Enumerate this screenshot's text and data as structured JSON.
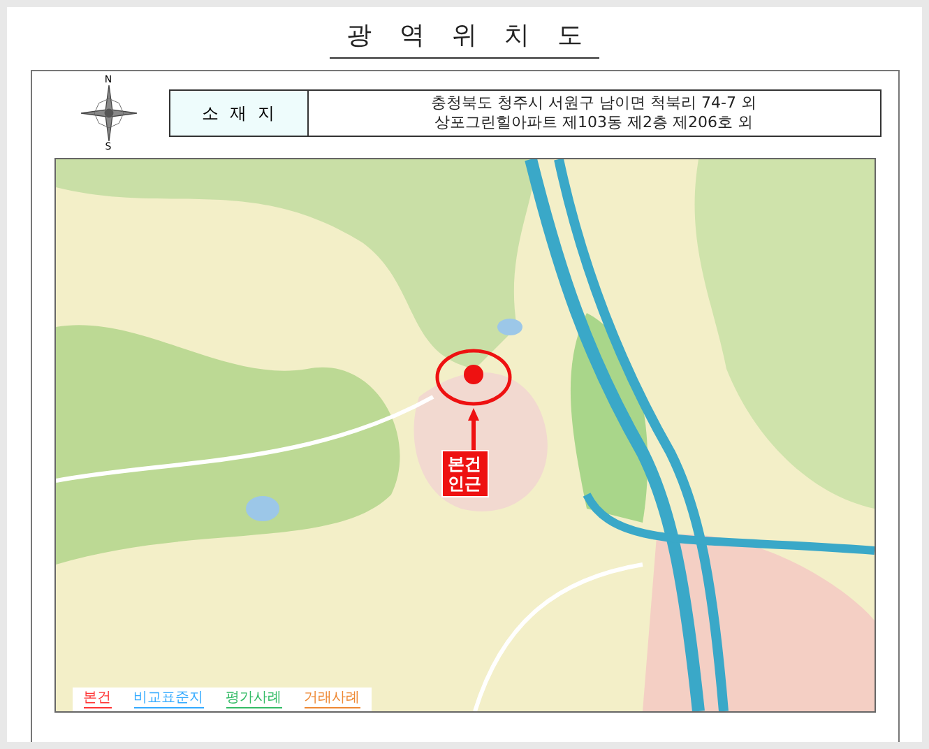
{
  "title": "광 역 위 치 도",
  "location": {
    "label": "소 재 지",
    "lines": [
      "충청북도 청주시 서원구 남이면 척북리 74-7 외",
      "상포그린힐아파트 제103동 제2층 제206호 외"
    ]
  },
  "compass": {
    "north": "N",
    "south": "S"
  },
  "map": {
    "marker_label": [
      "본건",
      "인근"
    ]
  },
  "legend": [
    {
      "label": "본건",
      "color": "#ff3333"
    },
    {
      "label": "비교표준지",
      "color": "#33aaff"
    },
    {
      "label": "평가사례",
      "color": "#33bb66"
    },
    {
      "label": "거래사례",
      "color": "#ee8833"
    }
  ]
}
